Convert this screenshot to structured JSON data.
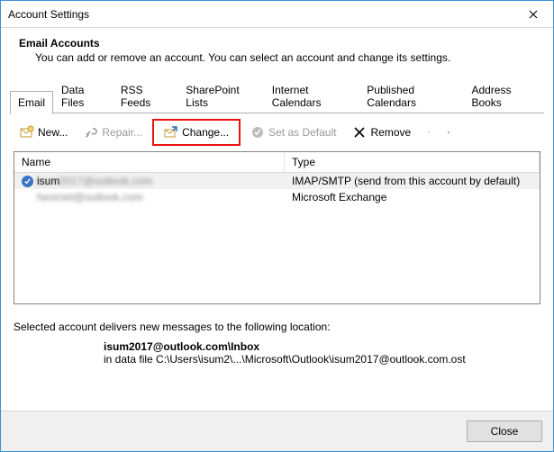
{
  "window": {
    "title": "Account Settings"
  },
  "header": {
    "heading": "Email Accounts",
    "description": "You can add or remove an account. You can select an account and change its settings."
  },
  "tabs": [
    {
      "label": "Email",
      "active": true
    },
    {
      "label": "Data Files"
    },
    {
      "label": "RSS Feeds"
    },
    {
      "label": "SharePoint Lists"
    },
    {
      "label": "Internet Calendars"
    },
    {
      "label": "Published Calendars"
    },
    {
      "label": "Address Books"
    }
  ],
  "toolbar": {
    "new": "New...",
    "repair": "Repair...",
    "change": "Change...",
    "set_default": "Set as Default",
    "remove": "Remove"
  },
  "columns": {
    "name": "Name",
    "type": "Type"
  },
  "accounts": [
    {
      "name": "isum2017@outlook.com",
      "type": "IMAP/SMTP (send from this account by default)",
      "default": true,
      "selected": true,
      "blurred": true
    },
    {
      "name": "heviciet@outlook.com",
      "type": "Microsoft Exchange",
      "default": false,
      "selected": false,
      "blurred": true
    }
  ],
  "delivery": {
    "intro": "Selected account delivers new messages to the following location:",
    "mailbox": "isum2017@outlook.com\\Inbox",
    "datafile": "in data file C:\\Users\\isum2\\...\\Microsoft\\Outlook\\isum2017@outlook.com.ost"
  },
  "footer": {
    "close": "Close"
  }
}
